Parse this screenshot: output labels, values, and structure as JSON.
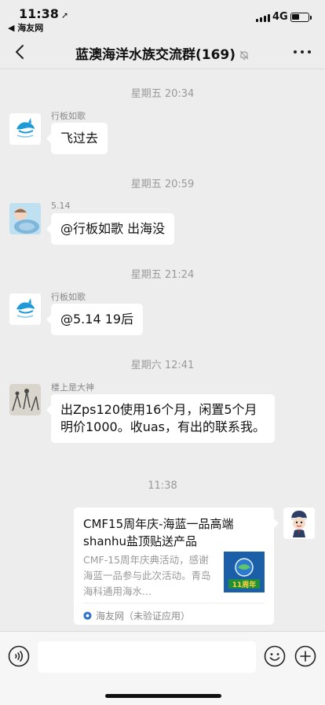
{
  "status_bar": {
    "time": "11:38",
    "back_app": "◀ 海友网",
    "network": "4G",
    "battery_level": 0.45
  },
  "nav": {
    "title": "蓝澳海洋水族交流群(169)",
    "back_icon": "chevron-left-icon",
    "mute_icon": "bell-off-icon",
    "more_icon": "more-dots-icon"
  },
  "messages": [
    {
      "timestamp": "星期五 20:34",
      "sender": "行板如歌",
      "text": "飞过去"
    },
    {
      "timestamp": "星期五 20:59",
      "sender": "5.14",
      "text": "@行板如歌 出海没"
    },
    {
      "timestamp": "星期五 21:24",
      "sender": "行板如歌",
      "text": "@5.14 19后"
    },
    {
      "timestamp": "星期六 12:41",
      "sender": "楼上是大神",
      "text": "出Zps120使用16个月，闲置5个月明价1000。收uas，有出的联系我。"
    }
  ],
  "card_message": {
    "timestamp": "11:38",
    "title": "CMF15周年庆-海蓝一品高端shanhu盐顶贴送产品",
    "description": "CMF-15周年庆典活动，感谢海蓝一品参与此次活动。青岛海科通用海水...",
    "source": "海友网（未验证应用）",
    "thumb_text": "11周年"
  },
  "input_bar": {
    "voice_icon": "voice-icon",
    "emoji_icon": "emoji-icon",
    "plus_icon": "plus-icon"
  }
}
